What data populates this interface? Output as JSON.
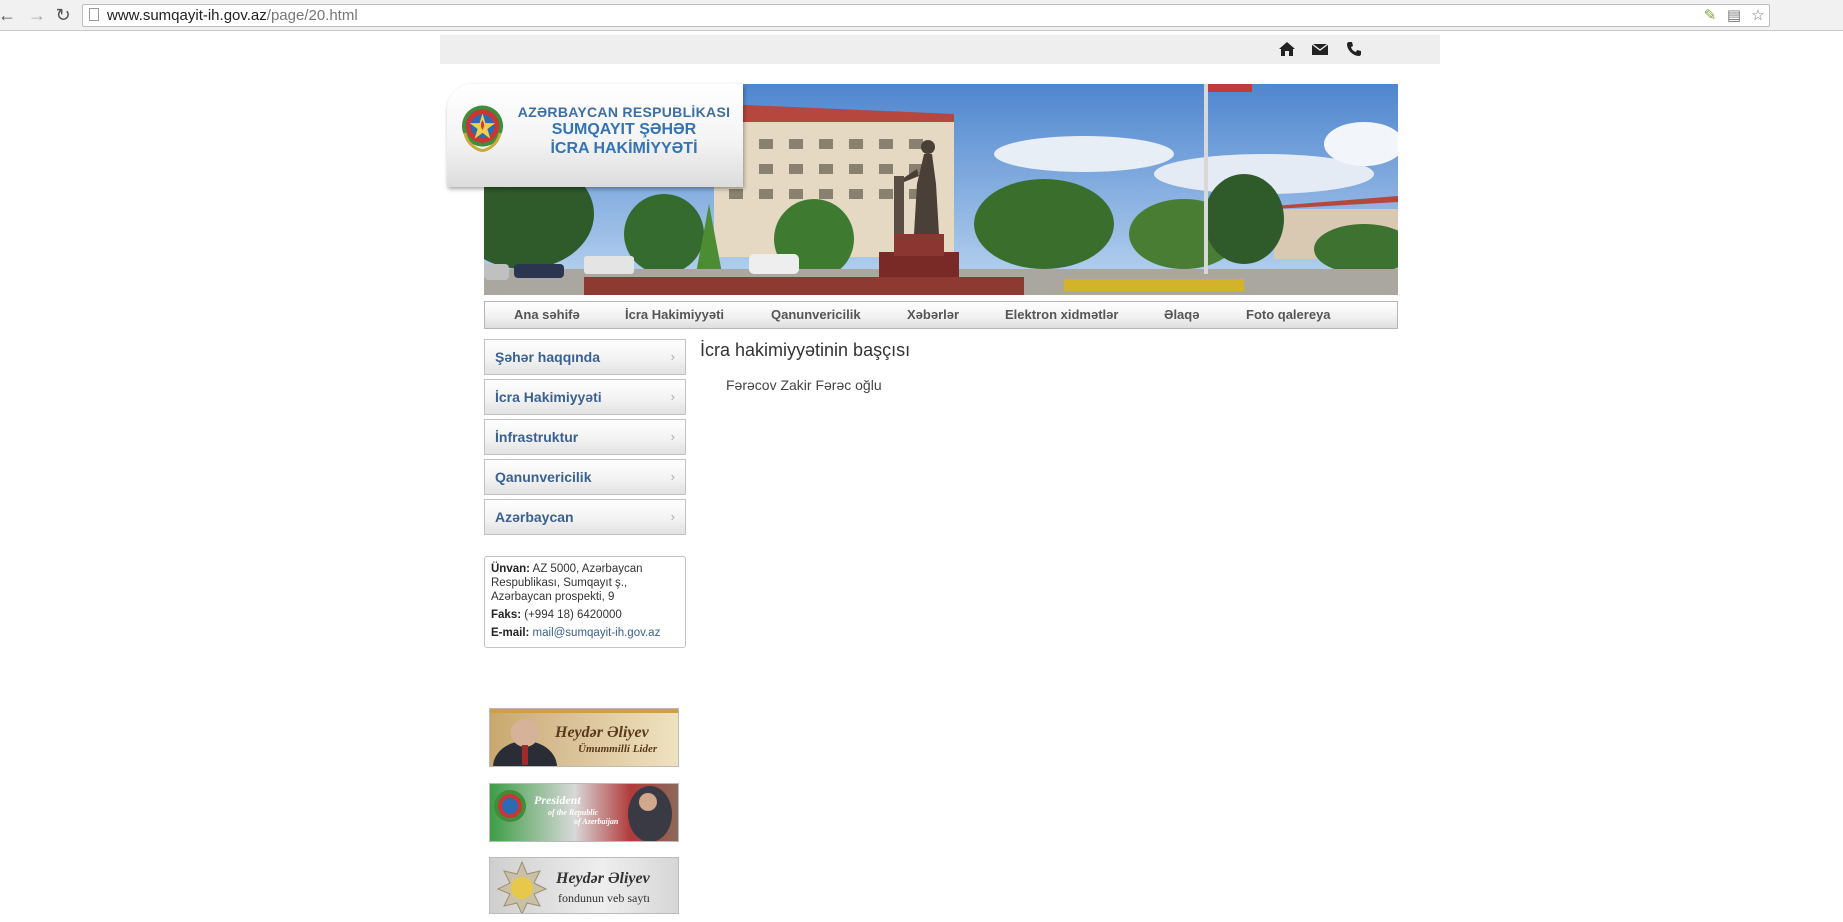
{
  "browser": {
    "url_host": "www.sumqayit-ih.gov.az",
    "url_path": "/page/20.html"
  },
  "top_icons": [
    "home-icon",
    "mail-icon",
    "phone-icon"
  ],
  "logo": {
    "line1": "AZƏRBAYCAN RESPUBLİKASI",
    "line2": "SUMQAYIT ŞƏHƏR",
    "line3": "İCRA HAKİMİYYƏTİ"
  },
  "menu": [
    {
      "label": "Ana səhifə"
    },
    {
      "label": "İcra Hakimiyyəti"
    },
    {
      "label": "Qanunvericilik"
    },
    {
      "label": "Xəbərlər"
    },
    {
      "label": "Elektron xidmətlər"
    },
    {
      "label": "Əlaqə"
    },
    {
      "label": "Foto qalereya"
    }
  ],
  "sidebar": [
    {
      "label": "Şəhər haqqında"
    },
    {
      "label": "İcra Hakimiyyəti"
    },
    {
      "label": "İnfrastruktur"
    },
    {
      "label": "Qanunvericilik"
    },
    {
      "label": "Azərbaycan"
    }
  ],
  "contact": {
    "address_label": "Ünvan:",
    "address": "AZ 5000, Azərbaycan Respublikası, Sumqayıt ş., Azərbaycan prospekti, 9",
    "fax_label": "Faks:",
    "fax": "(+994 18) 6420000",
    "email_label": "E-mail:",
    "email": "mail@sumqayit-ih.gov.az"
  },
  "banners": {
    "heydar": {
      "line1": "Heydər Əliyev",
      "line2": "Ümummilli Lider"
    },
    "president": {
      "line1": "President",
      "line2": "of the Republic",
      "line3": "of Azerbaijan"
    },
    "fund": {
      "line1": "Heydər Əliyev",
      "line2": "fondunun veb saytı"
    }
  },
  "content": {
    "title": "İcra hakimiyyətinin başçısı",
    "text": "Fərəcov Zakir Fərəc oğlu"
  },
  "colors": {
    "link_blue": "#3b6190",
    "logo_blue": "#3473b4",
    "strip_gray": "#eeeeee"
  }
}
